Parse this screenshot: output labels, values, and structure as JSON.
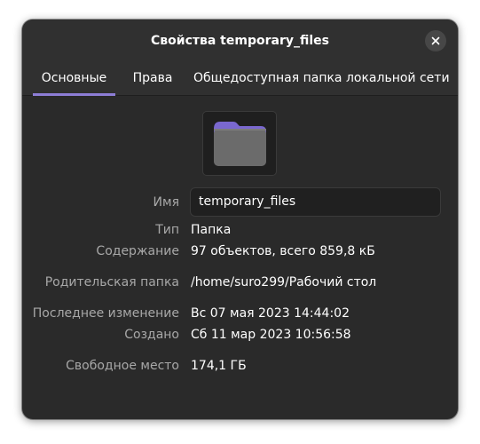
{
  "window": {
    "title": "Свойства temporary_files"
  },
  "tabs": [
    {
      "label": "Основные",
      "active": true
    },
    {
      "label": "Права",
      "active": false
    },
    {
      "label": "Общедоступная папка локальной сети",
      "active": false
    }
  ],
  "icons": {
    "close": "close-icon",
    "folder": "folder-icon"
  },
  "colors": {
    "accent": "#8e7ed6",
    "folder_tab": "#7a68cf",
    "folder_body": "#6b6b6b"
  },
  "properties": {
    "name_label": "Имя",
    "name_value": "temporary_files",
    "type_label": "Тип",
    "type_value": "Папка",
    "contents_label": "Содержание",
    "contents_value": "97 объектов, всего 859,8 кБ",
    "parent_label": "Родительская папка",
    "parent_value": "/home/suro299/Рабочий стол",
    "modified_label": "Последнее изменение",
    "modified_value": "Вс 07 мая 2023 14:44:02",
    "created_label": "Создано",
    "created_value": "Сб 11 мар 2023 10:56:58",
    "free_label": "Свободное место",
    "free_value": "174,1 ГБ"
  }
}
